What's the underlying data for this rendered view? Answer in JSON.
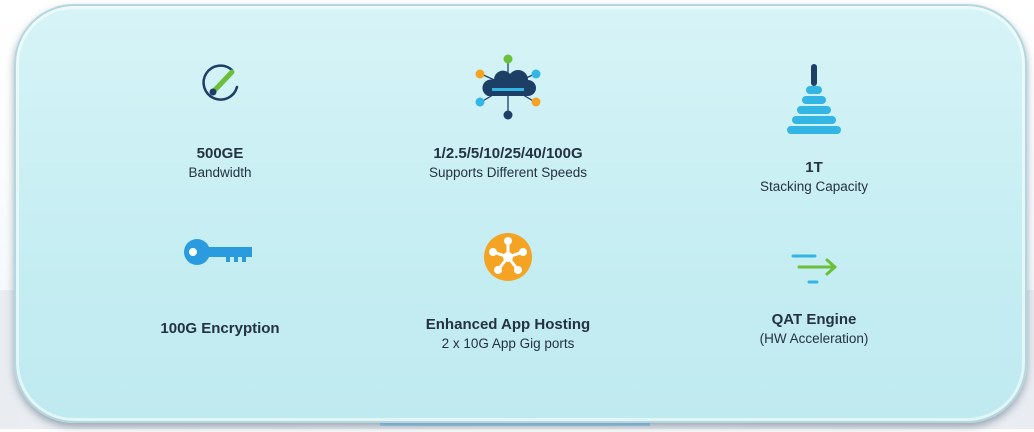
{
  "features": [
    {
      "title": "500GE",
      "subtitle": "Bandwidth",
      "icon": "speedometer-icon"
    },
    {
      "title": "1/2.5/5/10/25/40/100G",
      "subtitle": "Supports Different Speeds",
      "icon": "cloud-network-icon"
    },
    {
      "title": "1T",
      "subtitle": "Stacking Capacity",
      "icon": "stack-tower-icon"
    },
    {
      "title": "100G Encryption",
      "subtitle": "",
      "icon": "key-icon"
    },
    {
      "title": "Enhanced App Hosting",
      "subtitle": "2 x 10G App Gig ports",
      "icon": "app-hosting-icon"
    },
    {
      "title": "QAT Engine",
      "subtitle": "(HW Acceleration)",
      "icon": "acceleration-arrow-icon"
    }
  ],
  "colors": {
    "panel": "#c6eef3",
    "green": "#6cbf3a",
    "navy": "#1d3f66",
    "blue": "#2b9be0",
    "orange": "#f4a323",
    "cyan": "#34b6e4"
  }
}
